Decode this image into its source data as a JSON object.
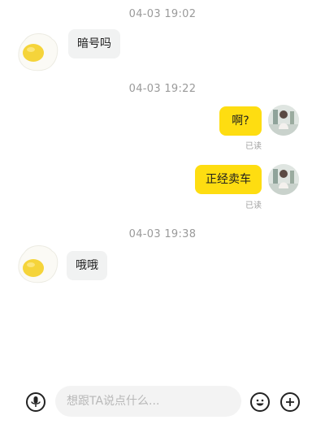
{
  "messages": [
    {
      "timestamp": "04-03 19:02",
      "side": "left",
      "text": "暗号吗"
    },
    {
      "timestamp": "04-03 19:22",
      "side": "right",
      "text": "啊?",
      "status": "已读"
    },
    {
      "side": "right",
      "text": "正经卖车",
      "status": "已读"
    },
    {
      "timestamp": "04-03 19:38",
      "side": "left",
      "text": "哦哦"
    }
  ],
  "input_bar": {
    "placeholder": "想跟TA说点什么...",
    "icons": [
      "microphone-icon",
      "emoji-icon",
      "plus-icon"
    ]
  },
  "colors": {
    "sent_bubble": "#fedd11",
    "received_bubble": "#f1f2f2",
    "timestamp_text": "#9a9a9a"
  }
}
